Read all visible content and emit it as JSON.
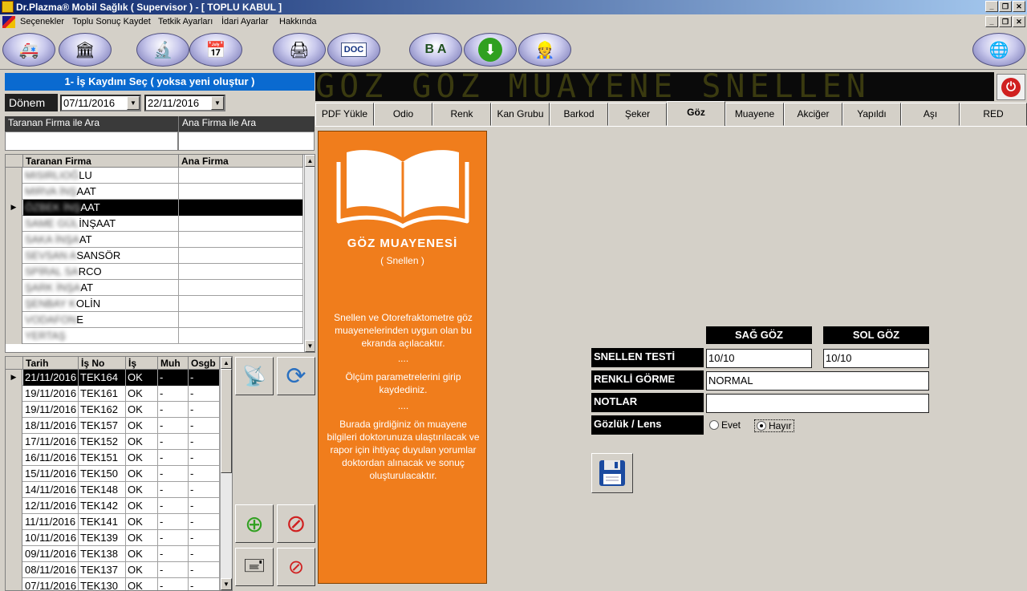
{
  "window": {
    "title": "Dr.Plazma® Mobil Sağlık ( Supervisor ) - [ TOPLU KABUL ]"
  },
  "menu": {
    "items": [
      "Seçenekler",
      "Toplu Sonuç Kaydet",
      "Tetkik Ayarları",
      "İdari Ayarlar",
      "Hakkında"
    ]
  },
  "toolbar": {
    "buttons": [
      "ambulance-icon",
      "bank-icon",
      "microscope-icon",
      "calendar-icon",
      "printer-icon",
      "word-doc-icon",
      "translate-icon",
      "download-icon",
      "worker-icon",
      "globe-icon"
    ]
  },
  "left": {
    "header": "1- İş Kaydını Seç ( yoksa yeni oluştur )",
    "donem_label": "Dönem",
    "date_from": "07/11/2016",
    "date_to": "22/11/2016",
    "search_firma_label": "Taranan Firma ile Ara",
    "search_ana_label": "Ana Firma ile Ara",
    "firma_grid": {
      "headers": [
        "Taranan Firma",
        "Ana Firma"
      ],
      "rows": [
        {
          "hidden": "MISIRLIOĞ",
          "visible": "LU",
          "ana": ""
        },
        {
          "hidden": "MIRVA İNŞ",
          "visible": "AAT",
          "ana": ""
        },
        {
          "hidden": "ÖZBEK İNŞ",
          "visible": "AAT",
          "ana": ""
        },
        {
          "hidden": "SAME GÜL",
          "visible": "İNŞAAT",
          "ana": ""
        },
        {
          "hidden": "SAKA İNŞA",
          "visible": "AT",
          "ana": ""
        },
        {
          "hidden": "SEVSAN A",
          "visible": "SANSÖR",
          "ana": ""
        },
        {
          "hidden": "SPİRAL SA",
          "visible": "RCO",
          "ana": ""
        },
        {
          "hidden": "ŞARK İNŞA",
          "visible": "AT",
          "ana": ""
        },
        {
          "hidden": "ŞENBAY K",
          "visible": "OLİN",
          "ana": ""
        },
        {
          "hidden": "VODAFON",
          "visible": "E",
          "ana": ""
        },
        {
          "hidden": "YERTAŞ",
          "visible": "",
          "ana": ""
        }
      ],
      "selected_index": 2
    },
    "job_grid": {
      "headers": [
        "Tarih",
        "İş No",
        "İş",
        "Muh",
        "Osgb"
      ],
      "rows": [
        [
          "21/11/2016",
          "TEK164",
          "OK",
          "-",
          "-"
        ],
        [
          "19/11/2016",
          "TEK161",
          "OK",
          "-",
          "-"
        ],
        [
          "19/11/2016",
          "TEK162",
          "OK",
          "-",
          "-"
        ],
        [
          "18/11/2016",
          "TEK157",
          "OK",
          "-",
          "-"
        ],
        [
          "17/11/2016",
          "TEK152",
          "OK",
          "-",
          "-"
        ],
        [
          "16/11/2016",
          "TEK151",
          "OK",
          "-",
          "-"
        ],
        [
          "15/11/2016",
          "TEK150",
          "OK",
          "-",
          "-"
        ],
        [
          "14/11/2016",
          "TEK148",
          "OK",
          "-",
          "-"
        ],
        [
          "12/11/2016",
          "TEK142",
          "OK",
          "-",
          "-"
        ],
        [
          "11/11/2016",
          "TEK141",
          "OK",
          "-",
          "-"
        ],
        [
          "10/11/2016",
          "TEK139",
          "OK",
          "-",
          "-"
        ],
        [
          "09/11/2016",
          "TEK138",
          "OK",
          "-",
          "-"
        ],
        [
          "08/11/2016",
          "TEK137",
          "OK",
          "-",
          "-"
        ],
        [
          "07/11/2016",
          "TEK130",
          "OK",
          "-",
          "-"
        ]
      ],
      "selected_index": 0
    }
  },
  "right": {
    "banner": "GÖZ GÖZ MUAYENE SNELLEN",
    "tabs": [
      "PDF Yükle",
      "Odio",
      "Renk",
      "Kan Grubu",
      "Barkod",
      "Şeker",
      "Göz",
      "Muayene",
      "Akciğer",
      "Yapıldı",
      "Aşı",
      "RED"
    ],
    "active_tab": "Göz",
    "info": {
      "title": "GÖZ MUAYENESİ",
      "subtitle": "( Snellen )",
      "p1": "Snellen ve Otorefraktometre göz muayenelerinden uygun olan bu ekranda açılacaktır.",
      "sep1": "....",
      "p2": "Ölçüm parametrelerini girip kaydediniz.",
      "sep2": "....",
      "p3": "Burada girdiğiniz ön muayene bilgileri doktorunuza ulaştırılacak ve rapor için ihtiyaç duyulan yorumlar doktordan alınacak ve sonuç oluşturulacaktır."
    },
    "form": {
      "col_right": "SAĞ GÖZ",
      "col_left": "SOL GÖZ",
      "snellen_label": "SNELLEN TESTİ",
      "snellen_right": "10/10",
      "snellen_left": "10/10",
      "renkli_label": "RENKLİ GÖRME",
      "renkli_value": "NORMAL",
      "notlar_label": "NOTLAR",
      "notlar_value": "",
      "gozluk_label": "Gözlük / Lens",
      "opt_yes": "Evet",
      "opt_no": "Hayır",
      "selected": "Hayır"
    }
  },
  "colors": {
    "accent_blue": "#0a6ad0",
    "info_orange": "#f07d1c",
    "title_gradient_start": "#0a246a"
  }
}
